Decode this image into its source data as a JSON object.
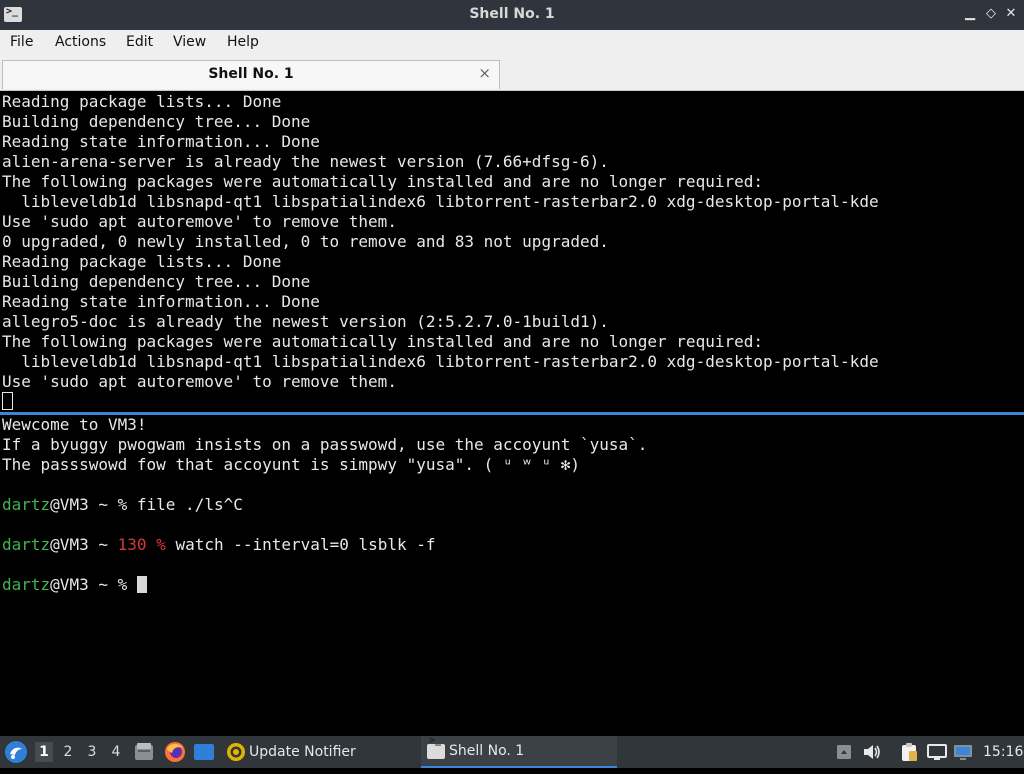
{
  "window": {
    "title": "Shell No. 1",
    "controls": {
      "minimize": "▁",
      "restore": "◇",
      "close": "✕"
    }
  },
  "menubar": {
    "items": [
      {
        "label": "File"
      },
      {
        "label": "Actions"
      },
      {
        "label": "Edit"
      },
      {
        "label": "View"
      },
      {
        "label": "Help"
      }
    ]
  },
  "tabs": [
    {
      "label": "Shell No. 1",
      "close": "×"
    }
  ],
  "terminal_top": {
    "lines": [
      "Reading package lists... Done",
      "Building dependency tree... Done",
      "Reading state information... Done",
      "alien-arena-server is already the newest version (7.66+dfsg-6).",
      "The following packages were automatically installed and are no longer required:",
      "  libleveldb1d libsnapd-qt1 libspatialindex6 libtorrent-rasterbar2.0 xdg-desktop-portal-kde",
      "Use 'sudo apt autoremove' to remove them.",
      "0 upgraded, 0 newly installed, 0 to remove and 83 not upgraded.",
      "Reading package lists... Done",
      "Building dependency tree... Done",
      "Reading state information... Done",
      "allegro5-doc is already the newest version (2:5.2.7.0-1build1).",
      "The following packages were automatically installed and are no longer required:",
      "  libleveldb1d libsnapd-qt1 libspatialindex6 libtorrent-rasterbar2.0 xdg-desktop-portal-kde",
      "Use 'sudo apt autoremove' to remove them."
    ]
  },
  "terminal_bottom": {
    "motd": [
      "Wewcome to VM3!",
      "If a byuggy pwogwam insists on a passwowd, use the accoyunt `yusa`.",
      "The passswowd fow that accoyunt is simpwy \"yusa\". ( ᵘ ʷ ᵘ ✻)"
    ],
    "prompt_user": "dartz",
    "prompt_host": "@VM3 ~ ",
    "prompt_symbol": "%",
    "error_code": "130",
    "cmd1": "file ./ls^C",
    "cmd2": "watch --interval=0 lsblk -f"
  },
  "taskbar": {
    "desktops": [
      "1",
      "2",
      "3",
      "4"
    ],
    "tasks": [
      {
        "label": "Update Notifier"
      },
      {
        "label": "Shell No. 1"
      }
    ],
    "clock": "15:16"
  },
  "colors": {
    "accent": "#3a86d8",
    "prompt_user": "#3fb54f",
    "error": "#d8383c"
  }
}
